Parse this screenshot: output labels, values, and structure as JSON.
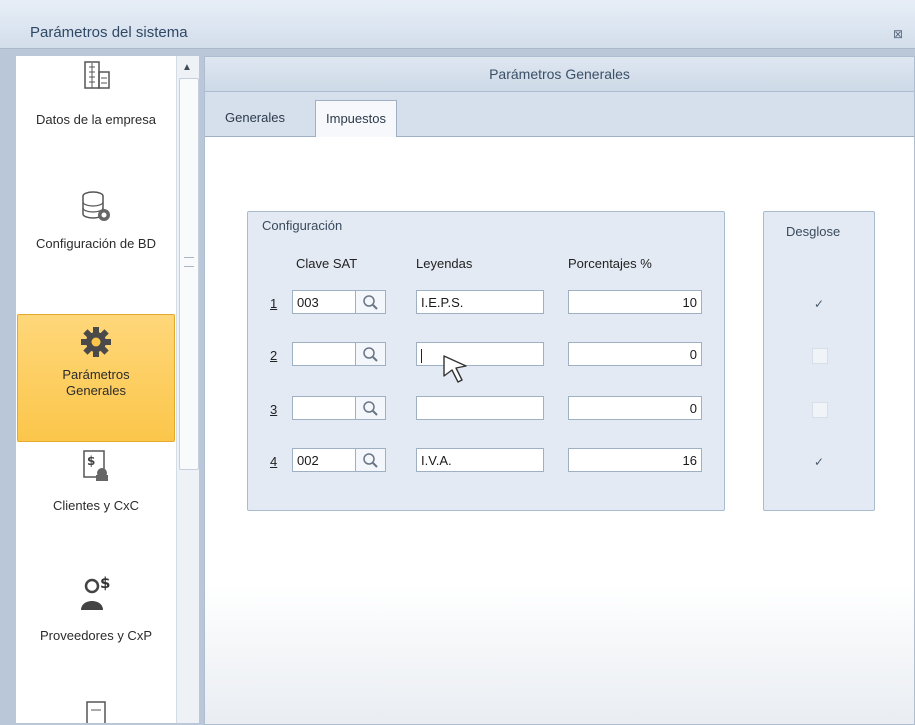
{
  "window": {
    "title": "Parámetros del sistema",
    "close_symbol": "⊠"
  },
  "sidebar": {
    "items": [
      {
        "label": "Datos de la empresa",
        "icon": "building-icon"
      },
      {
        "label": "Configuración de BD",
        "icon": "database-gear-icon"
      },
      {
        "label": "Parámetros Generales",
        "icon": "gear-icon",
        "active": true
      },
      {
        "label": "Clientes y CxC",
        "icon": "money-document-icon"
      },
      {
        "label": "Proveedores y CxP",
        "icon": "person-dollar-icon"
      }
    ]
  },
  "panel": {
    "header": "Parámetros Generales"
  },
  "tabs": [
    {
      "label": "Generales",
      "active": false
    },
    {
      "label": "Impuestos",
      "active": true
    }
  ],
  "config_group": {
    "title": "Configuración",
    "headers": {
      "clave": "Clave SAT",
      "leyendas": "Leyendas",
      "porcentajes": "Porcentajes %"
    },
    "rows": [
      {
        "num": "1",
        "clave": "003",
        "leyenda": "I.E.P.S.",
        "porcentaje": "10",
        "desglose": true
      },
      {
        "num": "2",
        "clave": "",
        "leyenda": "",
        "porcentaje": "0",
        "desglose": false
      },
      {
        "num": "3",
        "clave": "",
        "leyenda": "",
        "porcentaje": "0",
        "desglose": false
      },
      {
        "num": "4",
        "clave": "002",
        "leyenda": "I.V.A.",
        "porcentaje": "16",
        "desglose": true
      }
    ]
  },
  "desglose_group": {
    "title": "Desglose"
  },
  "colors": {
    "active_item": "#fbc64a",
    "accent": "#2f4864"
  }
}
